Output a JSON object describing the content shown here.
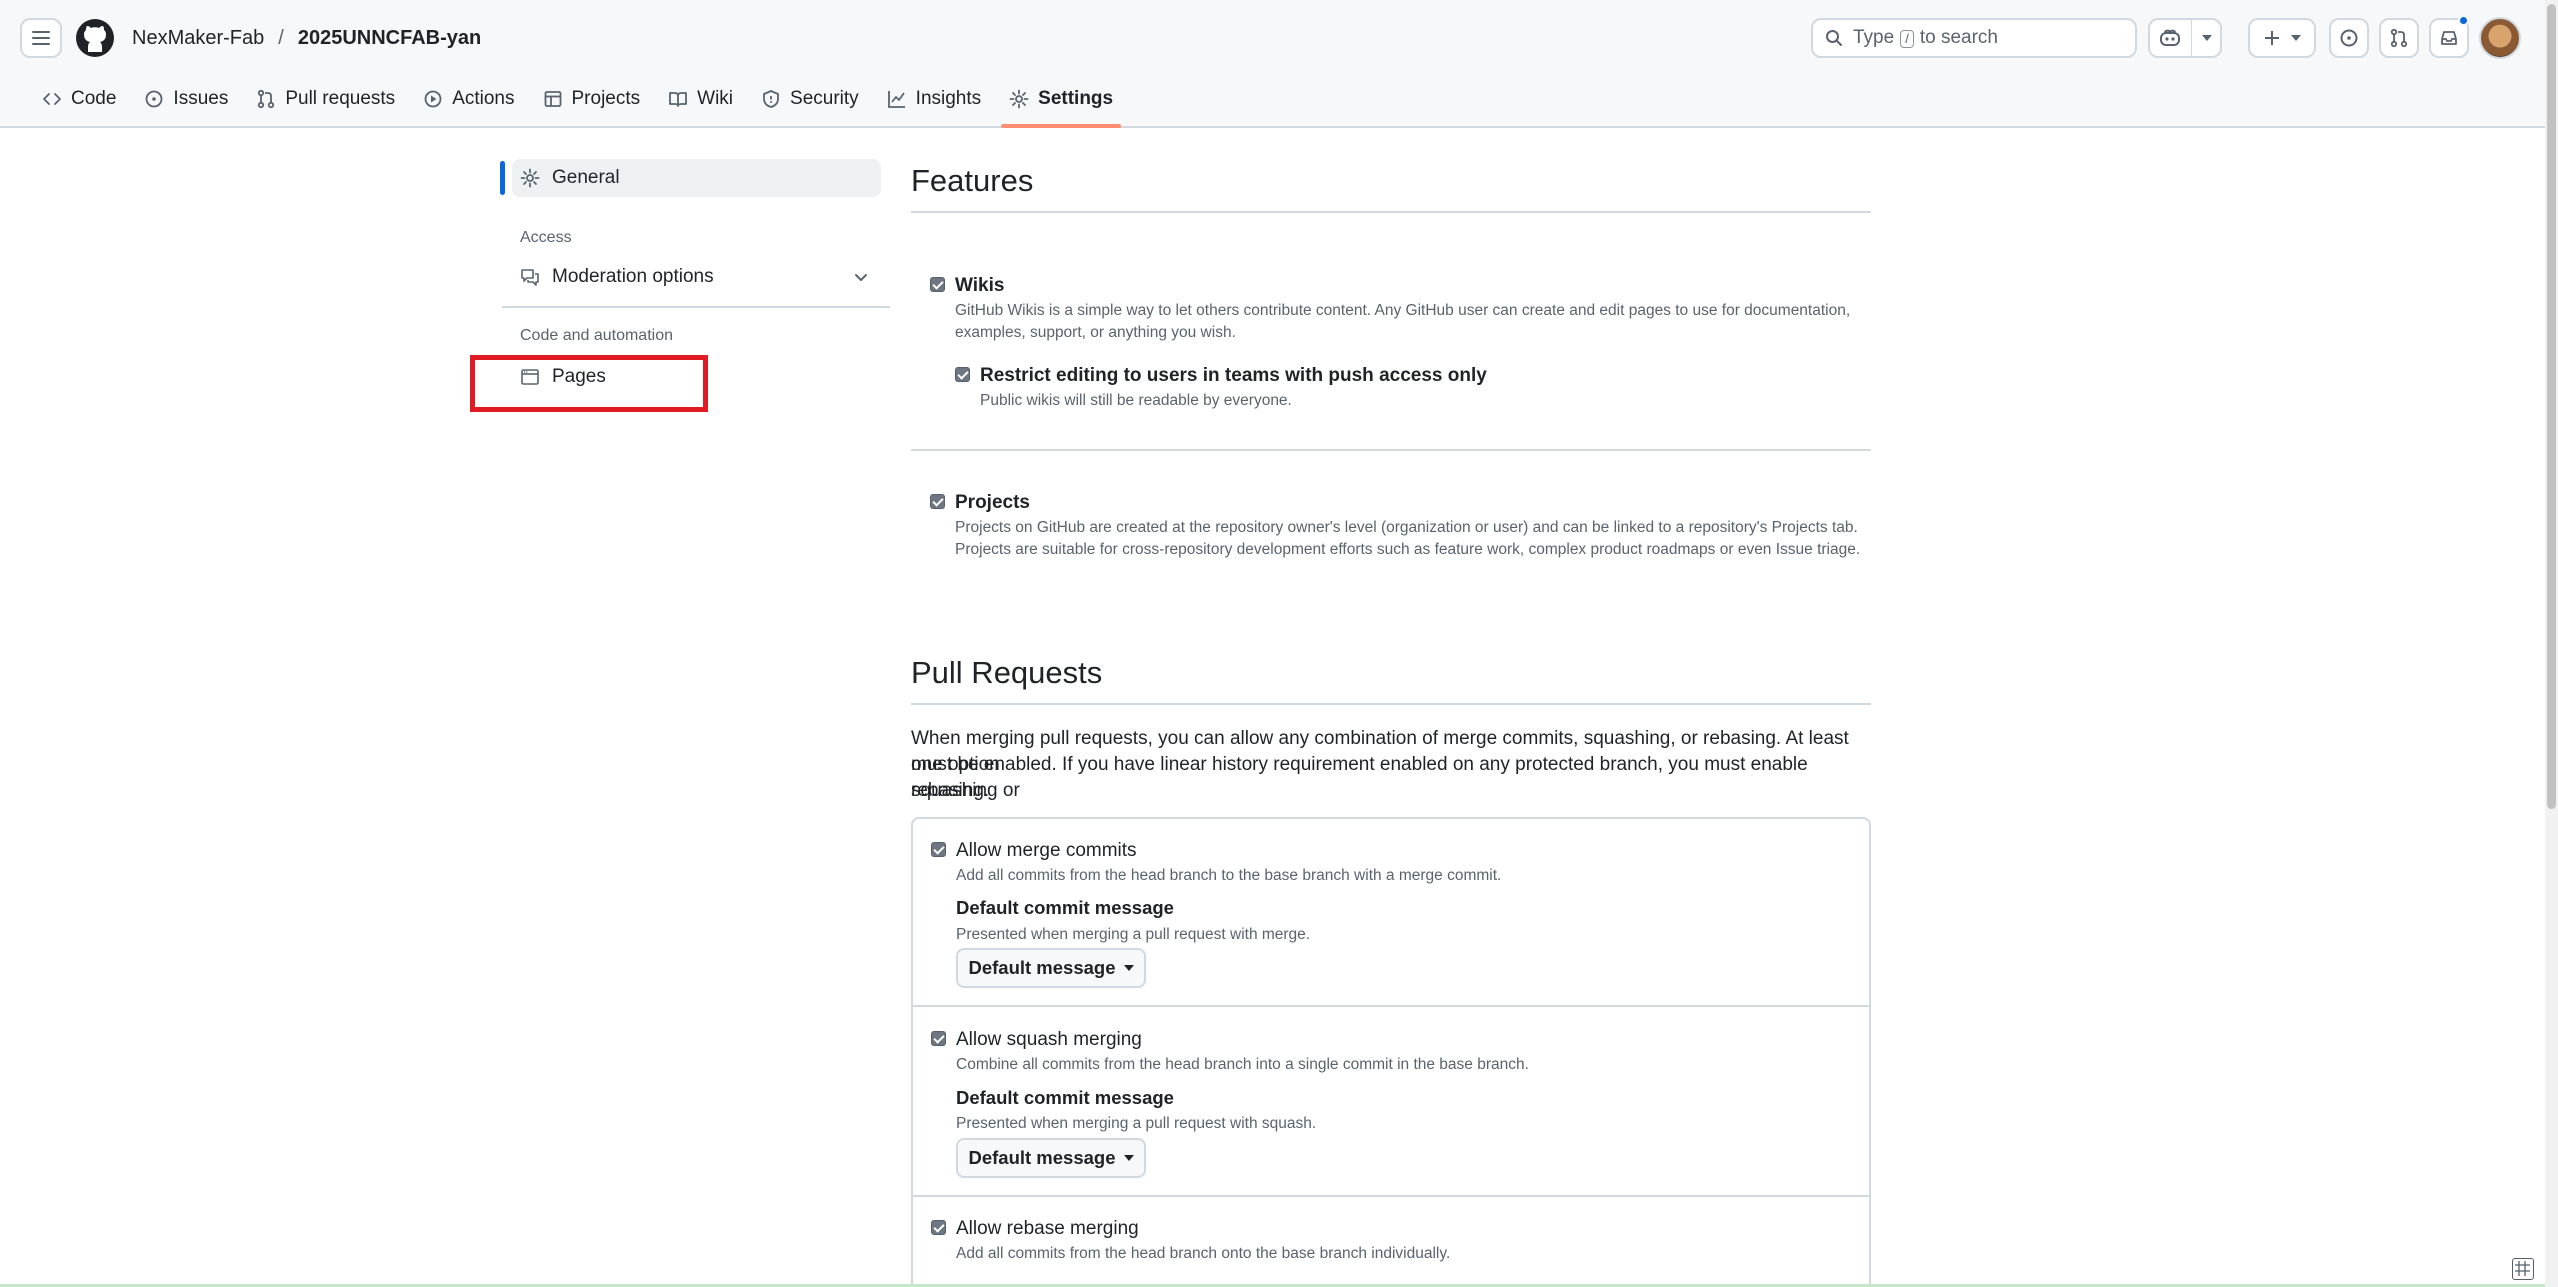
{
  "header": {
    "owner": "NexMaker-Fab",
    "separator": "/",
    "repo": "2025UNNCFAB-yan",
    "search": {
      "prefix": "Type",
      "key": "/",
      "suffix": "to search"
    }
  },
  "tabs": [
    {
      "label": "Code",
      "icon": "code-icon"
    },
    {
      "label": "Issues",
      "icon": "issue-opened-icon"
    },
    {
      "label": "Pull requests",
      "icon": "git-pull-request-icon"
    },
    {
      "label": "Actions",
      "icon": "play-icon"
    },
    {
      "label": "Projects",
      "icon": "table-icon"
    },
    {
      "label": "Wiki",
      "icon": "book-icon"
    },
    {
      "label": "Security",
      "icon": "shield-icon"
    },
    {
      "label": "Insights",
      "icon": "graph-icon"
    },
    {
      "label": "Settings",
      "icon": "gear-icon",
      "active": true
    }
  ],
  "sidebar": {
    "general": "General",
    "access_heading": "Access",
    "moderation": "Moderation options",
    "code_heading": "Code and automation",
    "pages": "Pages"
  },
  "features": {
    "title": "Features",
    "wikis": {
      "label": "Wikis",
      "desc_line1": "GitHub Wikis is a simple way to let others contribute content. Any GitHub user can create and edit pages to use for documentation,",
      "desc_line2": "examples, support, or anything you wish."
    },
    "restrict": {
      "label": "Restrict editing to users in teams with push access only",
      "desc": "Public wikis will still be readable by everyone."
    },
    "projects": {
      "label": "Projects",
      "desc_line1": "Projects on GitHub are created at the repository owner's level (organization or user) and can be linked to a repository's Projects tab.",
      "desc_line2": "Projects are suitable for cross-repository development efforts such as feature work, complex product roadmaps or even Issue triage."
    }
  },
  "pull_requests": {
    "title": "Pull Requests",
    "intro_line1": "When merging pull requests, you can allow any combination of merge commits, squashing, or rebasing. At least one option",
    "intro_line2": "must be enabled. If you have linear history requirement enabled on any protected branch, you must enable squashing or",
    "intro_line3": "rebasing.",
    "merge": {
      "label": "Allow merge commits",
      "desc": "Add all commits from the head branch to the base branch with a merge commit.",
      "sub_label": "Default commit message",
      "sub_desc": "Presented when merging a pull request with merge.",
      "button": "Default message"
    },
    "squash": {
      "label": "Allow squash merging",
      "desc": "Combine all commits from the head branch into a single commit in the base branch.",
      "sub_label": "Default commit message",
      "sub_desc": "Presented when merging a pull request with squash.",
      "button": "Default message"
    },
    "rebase": {
      "label": "Allow rebase merging",
      "desc": "Add all commits from the head branch onto the base branch individually."
    }
  }
}
